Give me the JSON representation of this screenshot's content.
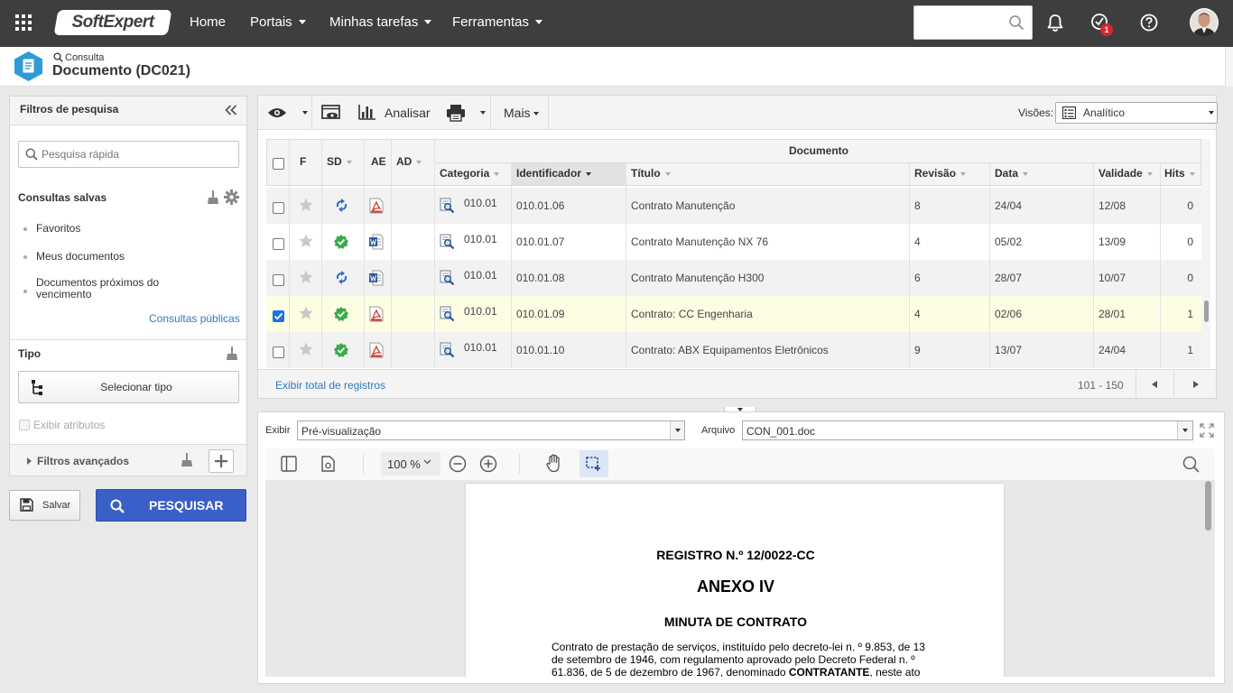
{
  "app": {
    "logo": "SoftExpert",
    "nav": [
      {
        "label": "Home",
        "dropdown": false
      },
      {
        "label": "Portais",
        "dropdown": true
      },
      {
        "label": "Minhas tarefas",
        "dropdown": true
      },
      {
        "label": "Ferramentas",
        "dropdown": true
      }
    ],
    "search_placeholder": "",
    "notification_badge": "1"
  },
  "page": {
    "breadcrumb": "Consulta",
    "title": "Documento (DC021)"
  },
  "sidebar": {
    "title": "Filtros de pesquisa",
    "quick_search_placeholder": "Pesquisa rápida",
    "saved_title": "Consultas salvas",
    "saved_items": [
      "Favoritos",
      "Meus documentos",
      "Documentos próximos do vencimento"
    ],
    "public_link": "Consultas públicas",
    "type_title": "Tipo",
    "select_type_label": "Selecionar tipo",
    "show_attributes_label": "Exibir atributos",
    "advanced_filters_label": "Filtros avançados",
    "save_label": "Salvar",
    "search_label": "PESQUISAR"
  },
  "toolbar": {
    "analyze_label": "Analisar",
    "more_label": "Mais",
    "views_label": "Visões:",
    "views_value": "Analítico"
  },
  "grid": {
    "group_header": "Documento",
    "columns": {
      "f": "F",
      "sd": "SD",
      "ae": "AE",
      "ad": "AD",
      "categoria": "Categoria",
      "identificador": "Identificador",
      "titulo": "Título",
      "revisao": "Revisão",
      "data": "Data",
      "validade": "Validade",
      "hits": "Hits"
    },
    "rows": [
      {
        "checked": false,
        "sd": "sync",
        "ae": "pdf",
        "categoria": "010.01",
        "identificador": "010.01.06",
        "titulo": "Contrato Manutenção",
        "revisao": "8",
        "data": "24/04",
        "validade": "12/08",
        "hits": "0"
      },
      {
        "checked": false,
        "sd": "approved",
        "ae": "word",
        "categoria": "010.01",
        "identificador": "010.01.07",
        "titulo": "Contrato Manutenção  NX 76",
        "revisao": "4",
        "data": "05/02",
        "validade": "13/09",
        "hits": "0"
      },
      {
        "checked": false,
        "sd": "sync",
        "ae": "word",
        "categoria": "010.01",
        "identificador": "010.01.08",
        "titulo": "Contrato Manutenção  H300",
        "revisao": "6",
        "data": "28/07",
        "validade": "10/07",
        "hits": "0"
      },
      {
        "checked": true,
        "sd": "approved",
        "ae": "pdf",
        "categoria": "010.01",
        "identificador": "010.01.09",
        "titulo": "Contrato: CC Engenharia",
        "revisao": "4",
        "data": "02/06",
        "validade": "28/01",
        "hits": "1"
      },
      {
        "checked": false,
        "sd": "approved",
        "ae": "pdf",
        "categoria": "010.01",
        "identificador": "010.01.10",
        "titulo": "Contrato: ABX Equipamentos Eletrônicos",
        "revisao": "9",
        "data": "13/07",
        "validade": "24/04",
        "hits": "1"
      }
    ],
    "total_link": "Exibir total de registros",
    "pagination": "101 - 150"
  },
  "preview": {
    "show_label": "Exibir",
    "show_value": "Pré-visualização",
    "file_label": "Arquivo",
    "file_value": "CON_001.doc",
    "zoom": "100 %",
    "doc": {
      "registro": "REGISTRO N.º 12/0022-CC",
      "anexo": "ANEXO IV",
      "minuta": "MINUTA DE  CONTRATO",
      "p1": "Contrato de prestação de serviços, instituído pelo decreto-lei n. º 9.853, de 13",
      "p2": "de setembro de 1946, com regulamento aprovado pelo Decreto Federal n. º",
      "p3_pre": "61.836, de 5 de dezembro de 1967, denominado ",
      "p3_bold": "CONTRATANTE",
      "p3_post": ", neste ato"
    }
  },
  "colors": {
    "topbar": "#3e3e3e",
    "primary_button": "#3a5fc8",
    "selected_row": "#fdfde3",
    "approved": "#3bab4a",
    "sync": "#2a6fd1",
    "pdf": "#d33a2c",
    "word": "#2b579a",
    "link": "#2f7bbf"
  }
}
